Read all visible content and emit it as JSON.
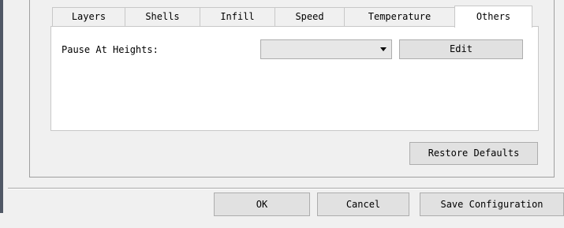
{
  "tabs": {
    "layers": "Layers",
    "shells": "Shells",
    "infill": "Infill",
    "speed": "Speed",
    "temperature": "Temperature",
    "others": "Others",
    "active": "Others"
  },
  "others_panel": {
    "pause_label": "Pause At Heights:",
    "pause_dropdown_value": "",
    "edit_label": "Edit"
  },
  "restore_defaults_label": "Restore Defaults",
  "dialog_buttons": {
    "ok": "OK",
    "cancel": "Cancel",
    "save": "Save Configuration"
  }
}
